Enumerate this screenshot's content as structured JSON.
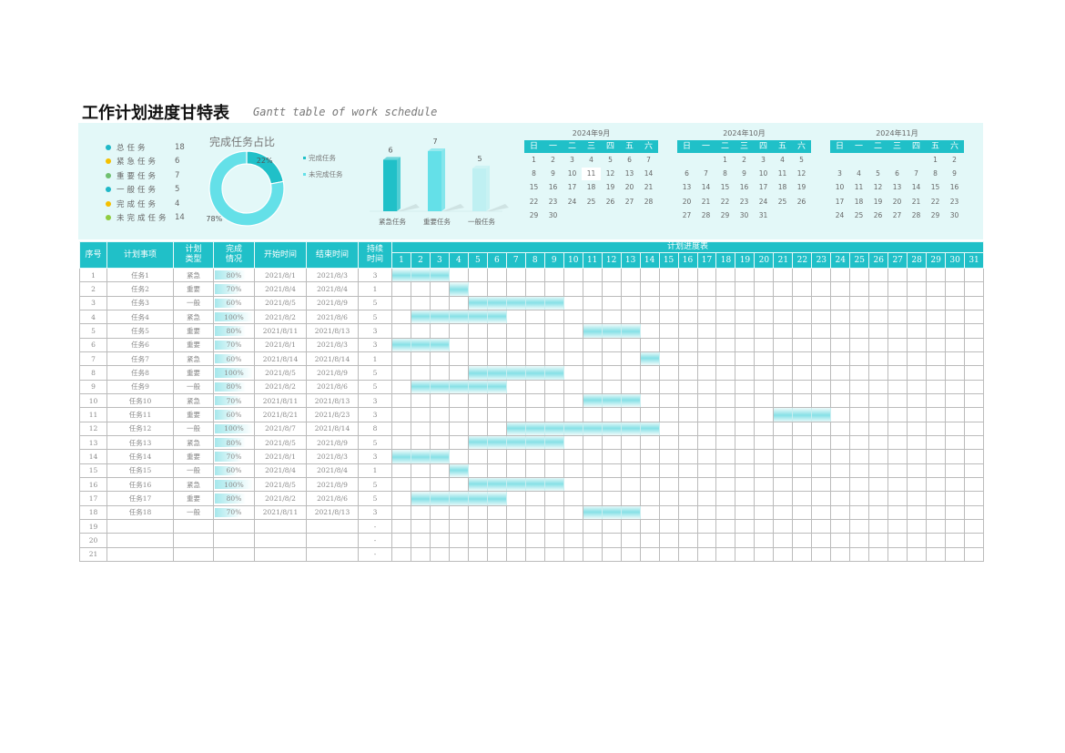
{
  "title": "工作计划进度甘特表",
  "subtitle": "Gantt table of work schedule",
  "colors": {
    "accent": "#20c0c8",
    "light": "#64e0e8",
    "pale": "#bff0f2",
    "panel": "#e3f8f8"
  },
  "summary": [
    {
      "label": "总任务",
      "value": "18",
      "color": "#20b8c8"
    },
    {
      "label": "紧急任务",
      "value": "6",
      "color": "#f5c000"
    },
    {
      "label": "重要任务",
      "value": "7",
      "color": "#70c070"
    },
    {
      "label": "一般任务",
      "value": "5",
      "color": "#20b8c8"
    },
    {
      "label": "完成任务",
      "value": "4",
      "color": "#f5c000"
    },
    {
      "label": "未完成任务",
      "value": "14",
      "color": "#90cc40"
    }
  ],
  "chart_data": [
    {
      "type": "pie",
      "title": "完成任务占比",
      "labels": [
        "完成任务",
        "未完成任务"
      ],
      "values": [
        22,
        78
      ],
      "value_labels": [
        "22%",
        "78%"
      ],
      "colors": [
        "#20c0c8",
        "#64e0e8"
      ],
      "donut": true,
      "legend": "right"
    },
    {
      "type": "bar",
      "categories": [
        "紧急任务",
        "重要任务",
        "一般任务"
      ],
      "values": [
        6,
        7,
        5
      ],
      "colors": [
        "#20c0c8",
        "#64e0e8",
        "#bff0f2"
      ],
      "ylim": [
        0,
        8
      ]
    }
  ],
  "calendars": [
    {
      "title": "2024年9月",
      "today": 11,
      "weeks": [
        [
          1,
          2,
          3,
          4,
          5,
          6,
          7
        ],
        [
          8,
          9,
          10,
          11,
          12,
          13,
          14
        ],
        [
          15,
          16,
          17,
          18,
          19,
          20,
          21
        ],
        [
          22,
          23,
          24,
          25,
          26,
          27,
          28
        ],
        [
          29,
          30,
          null,
          null,
          null,
          null,
          null
        ]
      ]
    },
    {
      "title": "2024年10月",
      "weeks": [
        [
          null,
          null,
          1,
          2,
          3,
          4,
          5
        ],
        [
          6,
          7,
          8,
          9,
          10,
          11,
          12
        ],
        [
          13,
          14,
          15,
          16,
          17,
          18,
          19
        ],
        [
          20,
          21,
          22,
          23,
          24,
          25,
          26
        ],
        [
          27,
          28,
          29,
          30,
          31,
          null,
          null
        ]
      ]
    },
    {
      "title": "2024年11月",
      "weeks": [
        [
          null,
          null,
          null,
          null,
          null,
          1,
          2
        ],
        [
          3,
          4,
          5,
          6,
          7,
          8,
          9
        ],
        [
          10,
          11,
          12,
          13,
          14,
          15,
          16
        ],
        [
          17,
          18,
          19,
          20,
          21,
          22,
          23
        ],
        [
          24,
          25,
          26,
          27,
          28,
          29,
          30
        ]
      ]
    }
  ],
  "weekdays": [
    "日",
    "一",
    "二",
    "三",
    "四",
    "五",
    "六"
  ],
  "table": {
    "headers": [
      "序号",
      "计划事项",
      "计划类型",
      "完成情况",
      "开始时间",
      "结束时间",
      "持续时间"
    ],
    "gantt_title": "计划进度表",
    "days": [
      1,
      2,
      3,
      4,
      5,
      6,
      7,
      8,
      9,
      10,
      11,
      12,
      13,
      14,
      15,
      16,
      17,
      18,
      19,
      20,
      21,
      22,
      23,
      24,
      25,
      26,
      27,
      28,
      29,
      30,
      31
    ],
    "rows": [
      {
        "no": "1",
        "task": "任务1",
        "type": "紧急",
        "pct": 80,
        "pct_text": "80%",
        "start": "2021/8/1",
        "end": "2021/8/3",
        "dur": "3",
        "s": 1,
        "e": 3
      },
      {
        "no": "2",
        "task": "任务2",
        "type": "重要",
        "pct": 70,
        "pct_text": "70%",
        "start": "2021/8/4",
        "end": "2021/8/4",
        "dur": "1",
        "s": 4,
        "e": 4
      },
      {
        "no": "3",
        "task": "任务3",
        "type": "一般",
        "pct": 60,
        "pct_text": "60%",
        "start": "2021/8/5",
        "end": "2021/8/9",
        "dur": "5",
        "s": 5,
        "e": 9
      },
      {
        "no": "4",
        "task": "任务4",
        "type": "紧急",
        "pct": 100,
        "pct_text": "100%",
        "start": "2021/8/2",
        "end": "2021/8/6",
        "dur": "5",
        "s": 2,
        "e": 6
      },
      {
        "no": "5",
        "task": "任务5",
        "type": "重要",
        "pct": 80,
        "pct_text": "80%",
        "start": "2021/8/11",
        "end": "2021/8/13",
        "dur": "3",
        "s": 11,
        "e": 13
      },
      {
        "no": "6",
        "task": "任务6",
        "type": "重要",
        "pct": 70,
        "pct_text": "70%",
        "start": "2021/8/1",
        "end": "2021/8/3",
        "dur": "3",
        "s": 1,
        "e": 3
      },
      {
        "no": "7",
        "task": "任务7",
        "type": "紧急",
        "pct": 60,
        "pct_text": "60%",
        "start": "2021/8/14",
        "end": "2021/8/14",
        "dur": "1",
        "s": 14,
        "e": 14
      },
      {
        "no": "8",
        "task": "任务8",
        "type": "重要",
        "pct": 100,
        "pct_text": "100%",
        "start": "2021/8/5",
        "end": "2021/8/9",
        "dur": "5",
        "s": 5,
        "e": 9
      },
      {
        "no": "9",
        "task": "任务9",
        "type": "一般",
        "pct": 80,
        "pct_text": "80%",
        "start": "2021/8/2",
        "end": "2021/8/6",
        "dur": "5",
        "s": 2,
        "e": 6
      },
      {
        "no": "10",
        "task": "任务10",
        "type": "紧急",
        "pct": 70,
        "pct_text": "70%",
        "start": "2021/8/11",
        "end": "2021/8/13",
        "dur": "3",
        "s": 11,
        "e": 13
      },
      {
        "no": "11",
        "task": "任务11",
        "type": "重要",
        "pct": 60,
        "pct_text": "60%",
        "start": "2021/8/21",
        "end": "2021/8/23",
        "dur": "3",
        "s": 21,
        "e": 23
      },
      {
        "no": "12",
        "task": "任务12",
        "type": "一般",
        "pct": 100,
        "pct_text": "100%",
        "start": "2021/8/7",
        "end": "2021/8/14",
        "dur": "8",
        "s": 7,
        "e": 14
      },
      {
        "no": "13",
        "task": "任务13",
        "type": "紧急",
        "pct": 80,
        "pct_text": "80%",
        "start": "2021/8/5",
        "end": "2021/8/9",
        "dur": "5",
        "s": 5,
        "e": 9
      },
      {
        "no": "14",
        "task": "任务14",
        "type": "重要",
        "pct": 70,
        "pct_text": "70%",
        "start": "2021/8/1",
        "end": "2021/8/3",
        "dur": "3",
        "s": 1,
        "e": 3
      },
      {
        "no": "15",
        "task": "任务15",
        "type": "一般",
        "pct": 60,
        "pct_text": "60%",
        "start": "2021/8/4",
        "end": "2021/8/4",
        "dur": "1",
        "s": 4,
        "e": 4
      },
      {
        "no": "16",
        "task": "任务16",
        "type": "紧急",
        "pct": 100,
        "pct_text": "100%",
        "start": "2021/8/5",
        "end": "2021/8/9",
        "dur": "5",
        "s": 5,
        "e": 9
      },
      {
        "no": "17",
        "task": "任务17",
        "type": "重要",
        "pct": 80,
        "pct_text": "80%",
        "start": "2021/8/2",
        "end": "2021/8/6",
        "dur": "5",
        "s": 2,
        "e": 6
      },
      {
        "no": "18",
        "task": "任务18",
        "type": "一般",
        "pct": 70,
        "pct_text": "70%",
        "start": "2021/8/11",
        "end": "2021/8/13",
        "dur": "3",
        "s": 11,
        "e": 13
      },
      {
        "no": "19",
        "task": "",
        "type": "",
        "pct": null,
        "pct_text": "",
        "start": "",
        "end": "",
        "dur": "-"
      },
      {
        "no": "20",
        "task": "",
        "type": "",
        "pct": null,
        "pct_text": "",
        "start": "",
        "end": "",
        "dur": "-"
      },
      {
        "no": "21",
        "task": "",
        "type": "",
        "pct": null,
        "pct_text": "",
        "start": "",
        "end": "",
        "dur": "-"
      }
    ]
  }
}
